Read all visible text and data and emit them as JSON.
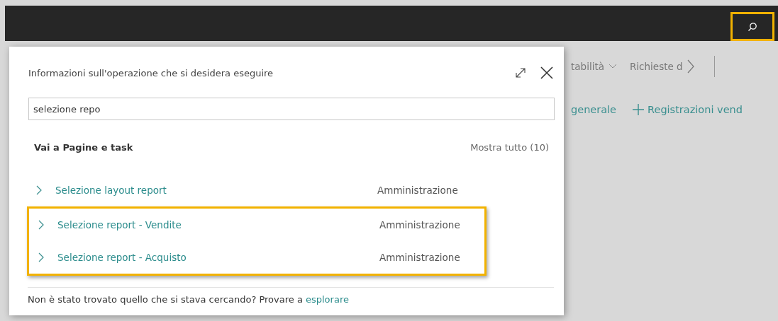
{
  "search_button": {
    "highlighted": true
  },
  "nav": [
    {
      "label": "tabilità",
      "kind": "menu"
    },
    {
      "label": "Richieste d",
      "kind": "more"
    }
  ],
  "actions": [
    {
      "label": "generale",
      "kind": "link"
    },
    {
      "label": "Registrazioni vend",
      "kind": "add"
    }
  ],
  "dialog": {
    "title": "Informazioni sull'operazione che si desidera eseguire",
    "search": {
      "value": "selezione repo"
    },
    "section": {
      "title": "Vai a Pagine e task",
      "show_all": "Mostra tutto (10)"
    },
    "results": [
      {
        "name": "Selezione layout report",
        "category": "Amministrazione",
        "highlighted": false
      },
      {
        "name": "Selezione report - Vendite",
        "category": "Amministrazione",
        "highlighted": true
      },
      {
        "name": "Selezione report - Acquisto",
        "category": "Amministrazione",
        "highlighted": true
      }
    ],
    "footer": {
      "text": "Non è stato trovato quello che si stava cercando? Provare a",
      "link": "esplorare"
    }
  }
}
